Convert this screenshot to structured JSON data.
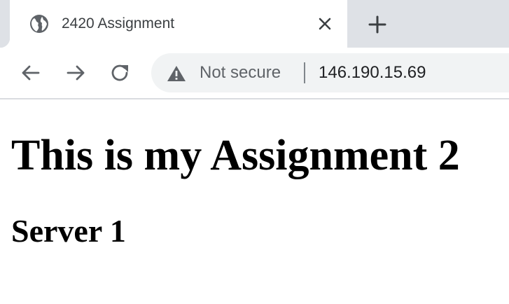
{
  "browser": {
    "tab": {
      "title": "2420 Assignment",
      "favicon": "globe-icon",
      "close_icon": "close-icon"
    },
    "new_tab_icon": "plus-icon",
    "toolbar": {
      "back_icon": "back-arrow-icon",
      "forward_icon": "forward-arrow-icon",
      "reload_icon": "reload-icon",
      "security_icon": "warning-icon",
      "security_label": "Not secure",
      "url": "146.190.15.69"
    }
  },
  "page": {
    "heading": "This is my Assignment 2",
    "subheading": "Server 1"
  },
  "colors": {
    "tabstrip_bg": "#dee1e6",
    "omnibox_bg": "#f1f3f4",
    "icon_gray": "#5f6368",
    "text_dark": "#202124"
  }
}
